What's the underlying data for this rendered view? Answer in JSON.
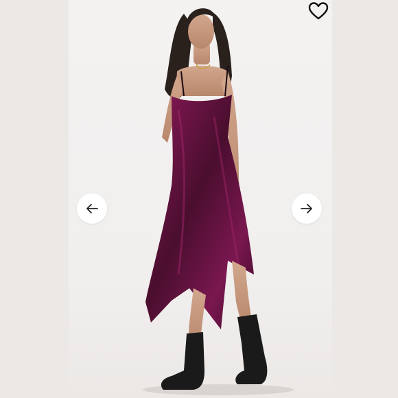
{
  "viewer": {
    "image_alt": "",
    "colors": {
      "dress": "#5a1238",
      "dress_highlight": "#8e1a5c",
      "skin": "#c99a80",
      "hair": "#2a211d",
      "boots": "#1a1a1a",
      "background": "#efecea"
    }
  },
  "controls": {
    "prev_icon": "arrow-left-icon",
    "next_icon": "arrow-right-icon",
    "like_icon": "heart-outline-icon"
  }
}
